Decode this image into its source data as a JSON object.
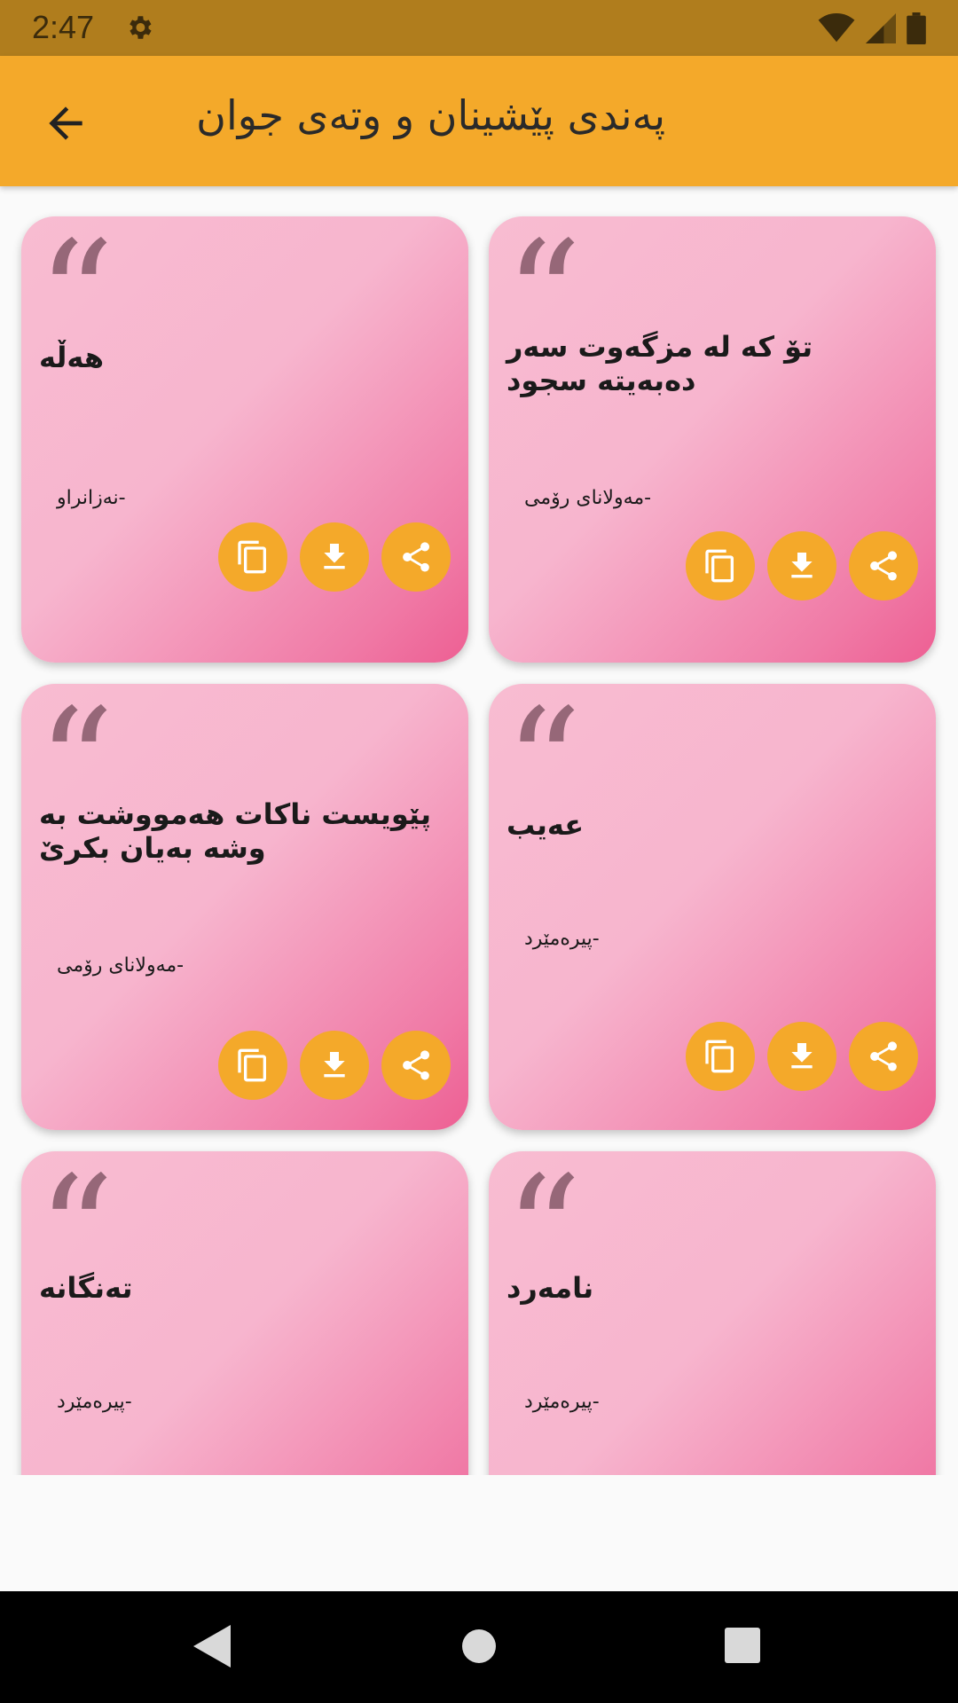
{
  "status_bar": {
    "time": "2:47",
    "icons": [
      "gear-icon",
      "wifi-icon",
      "signal-icon",
      "battery-icon"
    ]
  },
  "app_bar": {
    "title": "پەندی پێشینان و وتەی جوان",
    "back_icon": "arrow-back-icon",
    "background": "#f4a92a"
  },
  "colors": {
    "accent": "#f4a92a",
    "status_bar": "#b07d1d",
    "card_gradient_start": "#f8bcd1",
    "card_gradient_end": "#ed5f93"
  },
  "cards": [
    {
      "text": "هەڵە",
      "author": "-نەزانراو"
    },
    {
      "text": "تۆ کە لە مزگەوت سەر دەبەیتە سجود",
      "author": "-مەولانای رۆمی"
    },
    {
      "text": "پێویست ناکات هەمووشت بە وشە بەیان بکرێ",
      "author": "-مەولانای رۆمی"
    },
    {
      "text": "عەیب",
      "author": "-پیرەمێرد"
    },
    {
      "text": "تەنگانە",
      "author": "-پیرەمێرد"
    },
    {
      "text": "نامەرد",
      "author": "-پیرەمێرد"
    }
  ],
  "card_actions": [
    "copy-icon",
    "download-icon",
    "share-icon"
  ],
  "nav_bar": [
    "back-triangle-icon",
    "home-circle-icon",
    "recents-square-icon"
  ]
}
